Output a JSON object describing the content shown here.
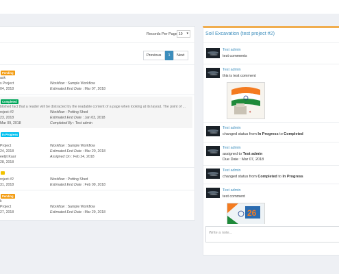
{
  "left": {
    "records_per_page_label": "Records Per Page",
    "records_per_page_value": "10",
    "pagination": {
      "previous": "Previous",
      "page": "1",
      "next": "Next"
    },
    "tasks": [
      {
        "badge": "Pending",
        "line1": "ask",
        "line2": "s Project",
        "line3": "04, 2018",
        "wf_label": "Workflow",
        "wf_value": "Sample Workflow",
        "end_label": "Estimated End Date",
        "end_value": "Mar 07, 2018"
      },
      {
        "badge": "Completed",
        "desc": "blished fact that a reader will be distracted by the readable content of a page when looking at its layout. The point of ...",
        "line2": "roject #2",
        "line3": "23, 2018",
        "line4": "Mar 09, 2018",
        "wf_label": "Workflow",
        "wf_value": "Potting Shed",
        "end_label": "Estimated End Date",
        "end_value": "Jan 03, 2018",
        "by_label": "Completed By",
        "by_value": "Test admin"
      },
      {
        "badge": "In Progress",
        "line2": "Project",
        "line3": "24, 2018",
        "line4": "eetjit Kaur",
        "line5": "28, 2018",
        "wf_label": "Workflow",
        "wf_value": "Sample Workflow",
        "end_label": "Estimated End Date",
        "end_value": "Mar 20, 2018",
        "asg_label": "Assigned On",
        "asg_value": "Feb 24, 2018"
      },
      {
        "line2": "roject #2",
        "line3": "31, 2018",
        "wf_label": "Workflow",
        "wf_value": "Potting Shed",
        "end_label": "Estimated End Date",
        "end_value": "Feb 09, 2018"
      },
      {
        "badge": "Pending",
        "line1": "k",
        "line2": "Project",
        "line3": "27, 2018",
        "wf_label": "Workflow",
        "wf_value": "Sample Workflow",
        "end_label": "Estimated End Date",
        "end_value": "Mar 29, 2018"
      }
    ]
  },
  "right": {
    "title": "Soil Excavation (test project #2)",
    "comments": [
      {
        "user": "Test admin",
        "text": "test comments"
      },
      {
        "user": "Test admin",
        "text": "this is test comment"
      },
      {
        "user": "Test admin",
        "pre": "changed status from ",
        "from": "In Progress",
        "mid": " to ",
        "to": "Completed"
      },
      {
        "user": "Test admin",
        "pre": "assigned to ",
        "to": "Test admin",
        "due_label": "Due Date : ",
        "due_value": "Mar 07, 2018"
      },
      {
        "user": "Test admin",
        "pre": "changed status from ",
        "from": "Completed",
        "mid": " to ",
        "to": "In Progress"
      },
      {
        "user": "Test admin",
        "text": "test comment"
      }
    ],
    "note_placeholder": "Write a note..."
  }
}
